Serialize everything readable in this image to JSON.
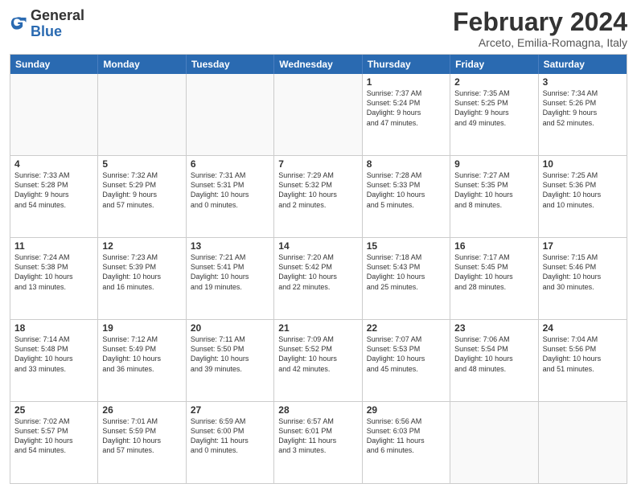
{
  "header": {
    "logo_general": "General",
    "logo_blue": "Blue",
    "month_title": "February 2024",
    "location": "Arceto, Emilia-Romagna, Italy"
  },
  "weekdays": [
    "Sunday",
    "Monday",
    "Tuesday",
    "Wednesday",
    "Thursday",
    "Friday",
    "Saturday"
  ],
  "rows": [
    [
      {
        "day": "",
        "text": "",
        "empty": true
      },
      {
        "day": "",
        "text": "",
        "empty": true
      },
      {
        "day": "",
        "text": "",
        "empty": true
      },
      {
        "day": "",
        "text": "",
        "empty": true
      },
      {
        "day": "1",
        "text": "Sunrise: 7:37 AM\nSunset: 5:24 PM\nDaylight: 9 hours\nand 47 minutes.",
        "empty": false
      },
      {
        "day": "2",
        "text": "Sunrise: 7:35 AM\nSunset: 5:25 PM\nDaylight: 9 hours\nand 49 minutes.",
        "empty": false
      },
      {
        "day": "3",
        "text": "Sunrise: 7:34 AM\nSunset: 5:26 PM\nDaylight: 9 hours\nand 52 minutes.",
        "empty": false
      }
    ],
    [
      {
        "day": "4",
        "text": "Sunrise: 7:33 AM\nSunset: 5:28 PM\nDaylight: 9 hours\nand 54 minutes.",
        "empty": false
      },
      {
        "day": "5",
        "text": "Sunrise: 7:32 AM\nSunset: 5:29 PM\nDaylight: 9 hours\nand 57 minutes.",
        "empty": false
      },
      {
        "day": "6",
        "text": "Sunrise: 7:31 AM\nSunset: 5:31 PM\nDaylight: 10 hours\nand 0 minutes.",
        "empty": false
      },
      {
        "day": "7",
        "text": "Sunrise: 7:29 AM\nSunset: 5:32 PM\nDaylight: 10 hours\nand 2 minutes.",
        "empty": false
      },
      {
        "day": "8",
        "text": "Sunrise: 7:28 AM\nSunset: 5:33 PM\nDaylight: 10 hours\nand 5 minutes.",
        "empty": false
      },
      {
        "day": "9",
        "text": "Sunrise: 7:27 AM\nSunset: 5:35 PM\nDaylight: 10 hours\nand 8 minutes.",
        "empty": false
      },
      {
        "day": "10",
        "text": "Sunrise: 7:25 AM\nSunset: 5:36 PM\nDaylight: 10 hours\nand 10 minutes.",
        "empty": false
      }
    ],
    [
      {
        "day": "11",
        "text": "Sunrise: 7:24 AM\nSunset: 5:38 PM\nDaylight: 10 hours\nand 13 minutes.",
        "empty": false
      },
      {
        "day": "12",
        "text": "Sunrise: 7:23 AM\nSunset: 5:39 PM\nDaylight: 10 hours\nand 16 minutes.",
        "empty": false
      },
      {
        "day": "13",
        "text": "Sunrise: 7:21 AM\nSunset: 5:41 PM\nDaylight: 10 hours\nand 19 minutes.",
        "empty": false
      },
      {
        "day": "14",
        "text": "Sunrise: 7:20 AM\nSunset: 5:42 PM\nDaylight: 10 hours\nand 22 minutes.",
        "empty": false
      },
      {
        "day": "15",
        "text": "Sunrise: 7:18 AM\nSunset: 5:43 PM\nDaylight: 10 hours\nand 25 minutes.",
        "empty": false
      },
      {
        "day": "16",
        "text": "Sunrise: 7:17 AM\nSunset: 5:45 PM\nDaylight: 10 hours\nand 28 minutes.",
        "empty": false
      },
      {
        "day": "17",
        "text": "Sunrise: 7:15 AM\nSunset: 5:46 PM\nDaylight: 10 hours\nand 30 minutes.",
        "empty": false
      }
    ],
    [
      {
        "day": "18",
        "text": "Sunrise: 7:14 AM\nSunset: 5:48 PM\nDaylight: 10 hours\nand 33 minutes.",
        "empty": false
      },
      {
        "day": "19",
        "text": "Sunrise: 7:12 AM\nSunset: 5:49 PM\nDaylight: 10 hours\nand 36 minutes.",
        "empty": false
      },
      {
        "day": "20",
        "text": "Sunrise: 7:11 AM\nSunset: 5:50 PM\nDaylight: 10 hours\nand 39 minutes.",
        "empty": false
      },
      {
        "day": "21",
        "text": "Sunrise: 7:09 AM\nSunset: 5:52 PM\nDaylight: 10 hours\nand 42 minutes.",
        "empty": false
      },
      {
        "day": "22",
        "text": "Sunrise: 7:07 AM\nSunset: 5:53 PM\nDaylight: 10 hours\nand 45 minutes.",
        "empty": false
      },
      {
        "day": "23",
        "text": "Sunrise: 7:06 AM\nSunset: 5:54 PM\nDaylight: 10 hours\nand 48 minutes.",
        "empty": false
      },
      {
        "day": "24",
        "text": "Sunrise: 7:04 AM\nSunset: 5:56 PM\nDaylight: 10 hours\nand 51 minutes.",
        "empty": false
      }
    ],
    [
      {
        "day": "25",
        "text": "Sunrise: 7:02 AM\nSunset: 5:57 PM\nDaylight: 10 hours\nand 54 minutes.",
        "empty": false
      },
      {
        "day": "26",
        "text": "Sunrise: 7:01 AM\nSunset: 5:59 PM\nDaylight: 10 hours\nand 57 minutes.",
        "empty": false
      },
      {
        "day": "27",
        "text": "Sunrise: 6:59 AM\nSunset: 6:00 PM\nDaylight: 11 hours\nand 0 minutes.",
        "empty": false
      },
      {
        "day": "28",
        "text": "Sunrise: 6:57 AM\nSunset: 6:01 PM\nDaylight: 11 hours\nand 3 minutes.",
        "empty": false
      },
      {
        "day": "29",
        "text": "Sunrise: 6:56 AM\nSunset: 6:03 PM\nDaylight: 11 hours\nand 6 minutes.",
        "empty": false
      },
      {
        "day": "",
        "text": "",
        "empty": true
      },
      {
        "day": "",
        "text": "",
        "empty": true
      }
    ]
  ]
}
